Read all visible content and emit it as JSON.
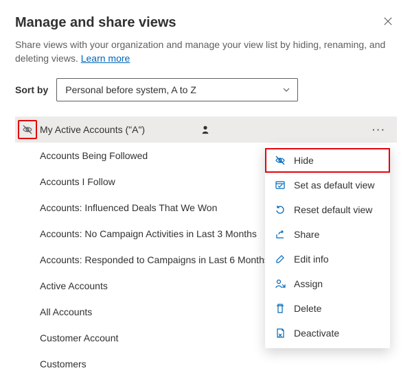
{
  "header": {
    "title": "Manage and share views",
    "description_prefix": "Share views with your organization and manage your view list by hiding, renaming, and deleting views. ",
    "learn_more": "Learn more"
  },
  "sort": {
    "label": "Sort by",
    "selected": "Personal before system, A to Z"
  },
  "views": [
    {
      "label": "My Active Accounts (\"A\")",
      "personal": true,
      "selected": true,
      "hidden_toggle": true
    },
    {
      "label": "Accounts Being Followed"
    },
    {
      "label": "Accounts I Follow"
    },
    {
      "label": "Accounts: Influenced Deals That We Won"
    },
    {
      "label": "Accounts: No Campaign Activities in Last 3 Months"
    },
    {
      "label": "Accounts: Responded to Campaigns in Last 6 Months"
    },
    {
      "label": "Active Accounts"
    },
    {
      "label": "All Accounts"
    },
    {
      "label": "Customer Account"
    },
    {
      "label": "Customers"
    }
  ],
  "menu": {
    "items": [
      {
        "icon": "hide-icon",
        "label": "Hide",
        "highlight": true
      },
      {
        "icon": "default-icon",
        "label": "Set as default view"
      },
      {
        "icon": "reset-icon",
        "label": "Reset default view"
      },
      {
        "icon": "share-icon",
        "label": "Share"
      },
      {
        "icon": "edit-icon",
        "label": "Edit info"
      },
      {
        "icon": "assign-icon",
        "label": "Assign"
      },
      {
        "icon": "delete-icon",
        "label": "Delete"
      },
      {
        "icon": "deactivate-icon",
        "label": "Deactivate"
      }
    ]
  },
  "icons": {
    "more": "···"
  }
}
